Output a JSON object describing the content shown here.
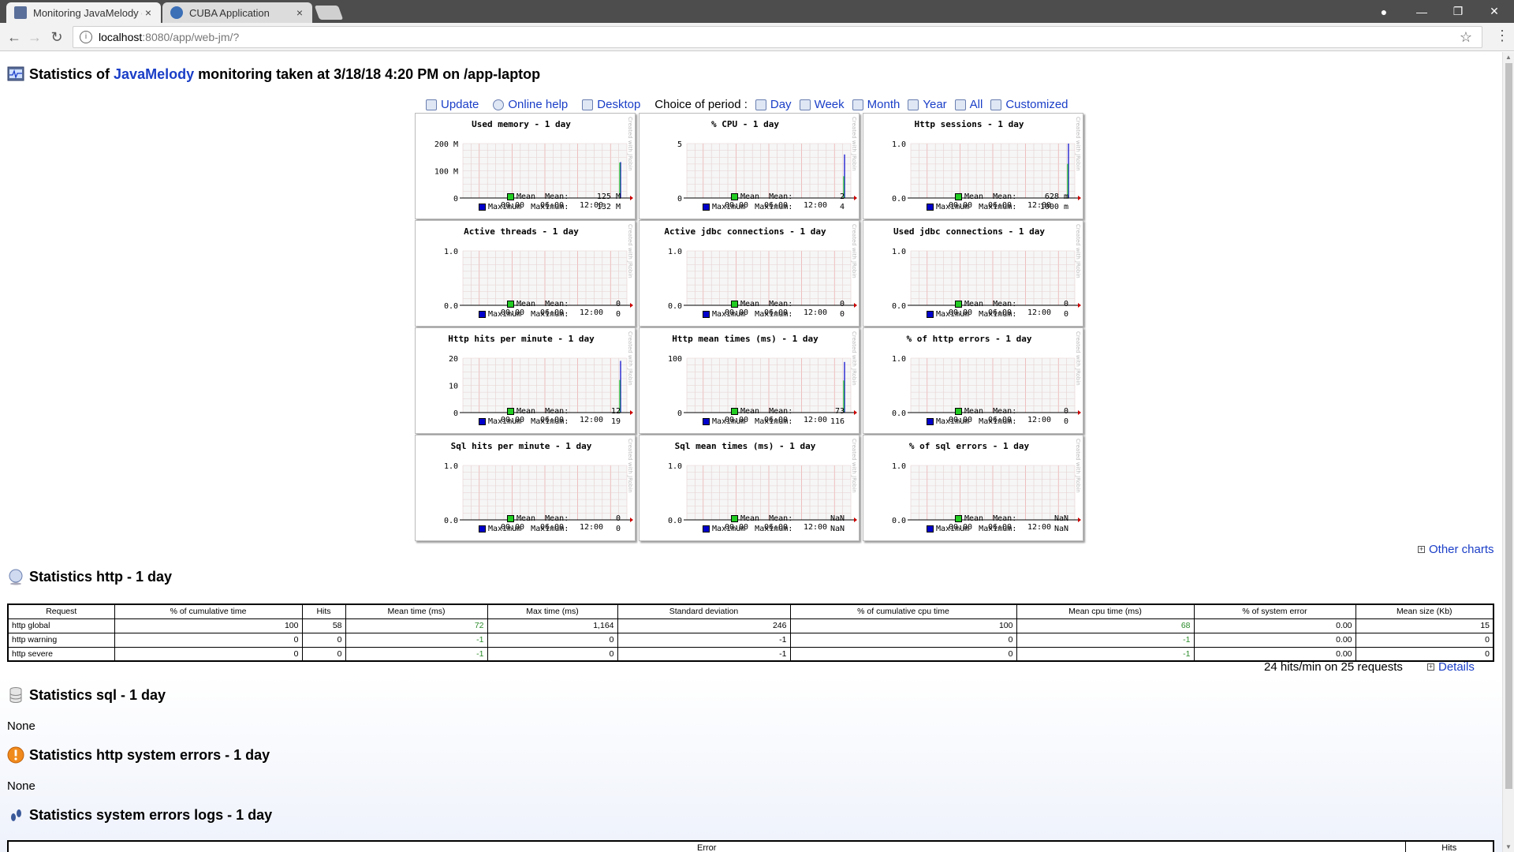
{
  "browser": {
    "tabs": [
      {
        "label": "Monitoring JavaMelody c",
        "active": true
      },
      {
        "label": "CUBA Application",
        "active": false
      }
    ],
    "url_host": "localhost",
    "url_path": ":8080/app/web-jm/?"
  },
  "page": {
    "title_prefix": "Statistics of ",
    "title_link": "JavaMelody",
    "title_suffix": " monitoring taken at 3/18/18 4:20 PM on /app-laptop"
  },
  "toolbar": {
    "update": "Update",
    "online_help": "Online help",
    "desktop": "Desktop",
    "period_label": "Choice of period :",
    "periods": [
      "Day",
      "Week",
      "Month",
      "Year",
      "All",
      "Customized"
    ]
  },
  "chart_data": [
    {
      "type": "bar",
      "title": "Used memory - 1 day",
      "yticks": [
        "200 M",
        "100 M",
        "0"
      ],
      "ylim": [
        0,
        200
      ],
      "xticks": [
        "00:00",
        "06:00",
        "12:00"
      ],
      "legend": {
        "mean_label": "Mean",
        "mean_key": "Mean:",
        "mean": "125 M",
        "max_label": "Maximum",
        "max_key": "Maximum:",
        "max": "132 M"
      },
      "spike": 0.65,
      "spike_color": "#22cc22",
      "max_spike": 0.66
    },
    {
      "type": "bar",
      "title": "% CPU - 1 day",
      "yticks": [
        "5",
        "0"
      ],
      "ylim": [
        0,
        5
      ],
      "xticks": [
        "00:00",
        "06:00",
        "12:00"
      ],
      "legend": {
        "mean_label": "Mean",
        "mean_key": "Mean:",
        "mean": "2",
        "max_label": "Maximum",
        "max_key": "Maximum:",
        "max": "4"
      },
      "spike": 0.4,
      "spike_color": "#22cc22",
      "max_spike": 0.8
    },
    {
      "type": "bar",
      "title": "Http sessions - 1 day",
      "yticks": [
        "1.0",
        "0.0"
      ],
      "ylim": [
        0,
        1
      ],
      "xticks": [
        "00:00",
        "06:00",
        "12:00"
      ],
      "legend": {
        "mean_label": "Mean",
        "mean_key": "Mean:",
        "mean": "628 m",
        "max_label": "Maximum",
        "max_key": "Maximum:",
        "max": "1000 m"
      },
      "spike": 0.628,
      "spike_color": "#22cc22",
      "max_spike": 1.0
    },
    {
      "type": "bar",
      "title": "Active threads - 1 day",
      "yticks": [
        "1.0",
        "0.0"
      ],
      "ylim": [
        0,
        1
      ],
      "xticks": [
        "00:00",
        "06:00",
        "12:00"
      ],
      "legend": {
        "mean_label": "Mean",
        "mean_key": "Mean:",
        "mean": "0",
        "max_label": "Maximum",
        "max_key": "Maximum:",
        "max": "0"
      },
      "spike": 0,
      "spike_color": "#22cc22",
      "max_spike": 0
    },
    {
      "type": "bar",
      "title": "Active jdbc connections - 1 day",
      "yticks": [
        "1.0",
        "0.0"
      ],
      "ylim": [
        0,
        1
      ],
      "xticks": [
        "00:00",
        "06:00",
        "12:00"
      ],
      "legend": {
        "mean_label": "Mean",
        "mean_key": "Mean:",
        "mean": "0",
        "max_label": "Maximum",
        "max_key": "Maximum:",
        "max": "0"
      },
      "spike": 0,
      "spike_color": "#22cc22",
      "max_spike": 0
    },
    {
      "type": "bar",
      "title": "Used jdbc connections - 1 day",
      "yticks": [
        "1.0",
        "0.0"
      ],
      "ylim": [
        0,
        1
      ],
      "xticks": [
        "00:00",
        "06:00",
        "12:00"
      ],
      "legend": {
        "mean_label": "Mean",
        "mean_key": "Mean:",
        "mean": "0",
        "max_label": "Maximum",
        "max_key": "Maximum:",
        "max": "0"
      },
      "spike": 0,
      "spike_color": "#22cc22",
      "max_spike": 0
    },
    {
      "type": "bar",
      "title": "Http hits per minute - 1 day",
      "yticks": [
        "20",
        "10",
        "0"
      ],
      "ylim": [
        0,
        20
      ],
      "xticks": [
        "00:00",
        "06:00",
        "12:00"
      ],
      "legend": {
        "mean_label": "Mean",
        "mean_key": "Mean:",
        "mean": "12",
        "max_label": "Maximum",
        "max_key": "Maximum:",
        "max": "19"
      },
      "spike": 0.6,
      "spike_color": "#22cc22",
      "max_spike": 0.95
    },
    {
      "type": "bar",
      "title": "Http mean times (ms) - 1 day",
      "yticks": [
        "100",
        "0"
      ],
      "ylim": [
        0,
        124
      ],
      "xticks": [
        "00:00",
        "06:00",
        "12:00"
      ],
      "legend": {
        "mean_label": "Mean",
        "mean_key": "Mean:",
        "mean": "73",
        "max_label": "Maximum",
        "max_key": "Maximum:",
        "max": "116"
      },
      "spike": 0.59,
      "spike_color": "#22cc22",
      "max_spike": 0.93
    },
    {
      "type": "bar",
      "title": "% of http errors - 1 day",
      "yticks": [
        "1.0",
        "0.0"
      ],
      "ylim": [
        0,
        1
      ],
      "xticks": [
        "00:00",
        "06:00",
        "12:00"
      ],
      "legend": {
        "mean_label": "Mean",
        "mean_key": "Mean:",
        "mean": "0",
        "max_label": "Maximum",
        "max_key": "Maximum:",
        "max": "0"
      },
      "spike": 0,
      "spike_color": "#22cc22",
      "max_spike": 0
    },
    {
      "type": "bar",
      "title": "Sql hits per minute - 1 day",
      "yticks": [
        "1.0",
        "0.0"
      ],
      "ylim": [
        0,
        1
      ],
      "xticks": [
        "00:00",
        "06:00",
        "12:00"
      ],
      "legend": {
        "mean_label": "Mean",
        "mean_key": "Mean:",
        "mean": "0",
        "max_label": "Maximum",
        "max_key": "Maximum:",
        "max": "0"
      },
      "spike": 0,
      "spike_color": "#22cc22",
      "max_spike": 0
    },
    {
      "type": "bar",
      "title": "Sql mean times (ms) - 1 day",
      "yticks": [
        "1.0",
        "0.0"
      ],
      "ylim": [
        0,
        1
      ],
      "xticks": [
        "00:00",
        "06:00",
        "12:00"
      ],
      "legend": {
        "mean_label": "Mean",
        "mean_key": "Mean:",
        "mean": "NaN",
        "max_label": "Maximum",
        "max_key": "Maximum:",
        "max": "NaN"
      },
      "spike": 0,
      "spike_color": "#22cc22",
      "max_spike": 0
    },
    {
      "type": "bar",
      "title": "% of sql errors - 1 day",
      "yticks": [
        "1.0",
        "0.0"
      ],
      "ylim": [
        0,
        1
      ],
      "xticks": [
        "00:00",
        "06:00",
        "12:00"
      ],
      "legend": {
        "mean_label": "Mean",
        "mean_key": "Mean:",
        "mean": "NaN",
        "max_label": "Maximum",
        "max_key": "Maximum:",
        "max": "NaN"
      },
      "spike": 0,
      "spike_color": "#22cc22",
      "max_spike": 0
    }
  ],
  "chart_side_text": "Created with JRobin",
  "other_charts": "Other charts",
  "http_section": {
    "title": "Statistics http - 1 day",
    "columns": [
      "Request",
      "% of cumulative time",
      "Hits",
      "Mean time (ms)",
      "Max time (ms)",
      "Standard deviation",
      "% of cumulative cpu time",
      "Mean cpu time (ms)",
      "% of system error",
      "Mean size (Kb)"
    ],
    "rows": [
      [
        "http global",
        "100",
        "58",
        "72",
        "1,164",
        "246",
        "100",
        "68",
        "0.00",
        "15"
      ],
      [
        "http warning",
        "0",
        "0",
        "-1",
        "0",
        "-1",
        "0",
        "-1",
        "0.00",
        "0"
      ],
      [
        "http severe",
        "0",
        "0",
        "-1",
        "0",
        "-1",
        "0",
        "-1",
        "0.00",
        "0"
      ]
    ],
    "summary": "24 hits/min on 25 requests",
    "details": "Details"
  },
  "sql_section": {
    "title": "Statistics sql - 1 day",
    "content": "None"
  },
  "http_errors_section": {
    "title": "Statistics http system errors - 1 day",
    "content": "None"
  },
  "error_logs_section": {
    "title": "Statistics system errors logs - 1 day",
    "columns": [
      "Error",
      "Hits"
    ]
  },
  "colors": {
    "link": "#1a3ec7",
    "mean": "#22cc22",
    "max": "#0000cc",
    "grid": "#f0b8b8",
    "green_value": "#2a8a2a"
  }
}
